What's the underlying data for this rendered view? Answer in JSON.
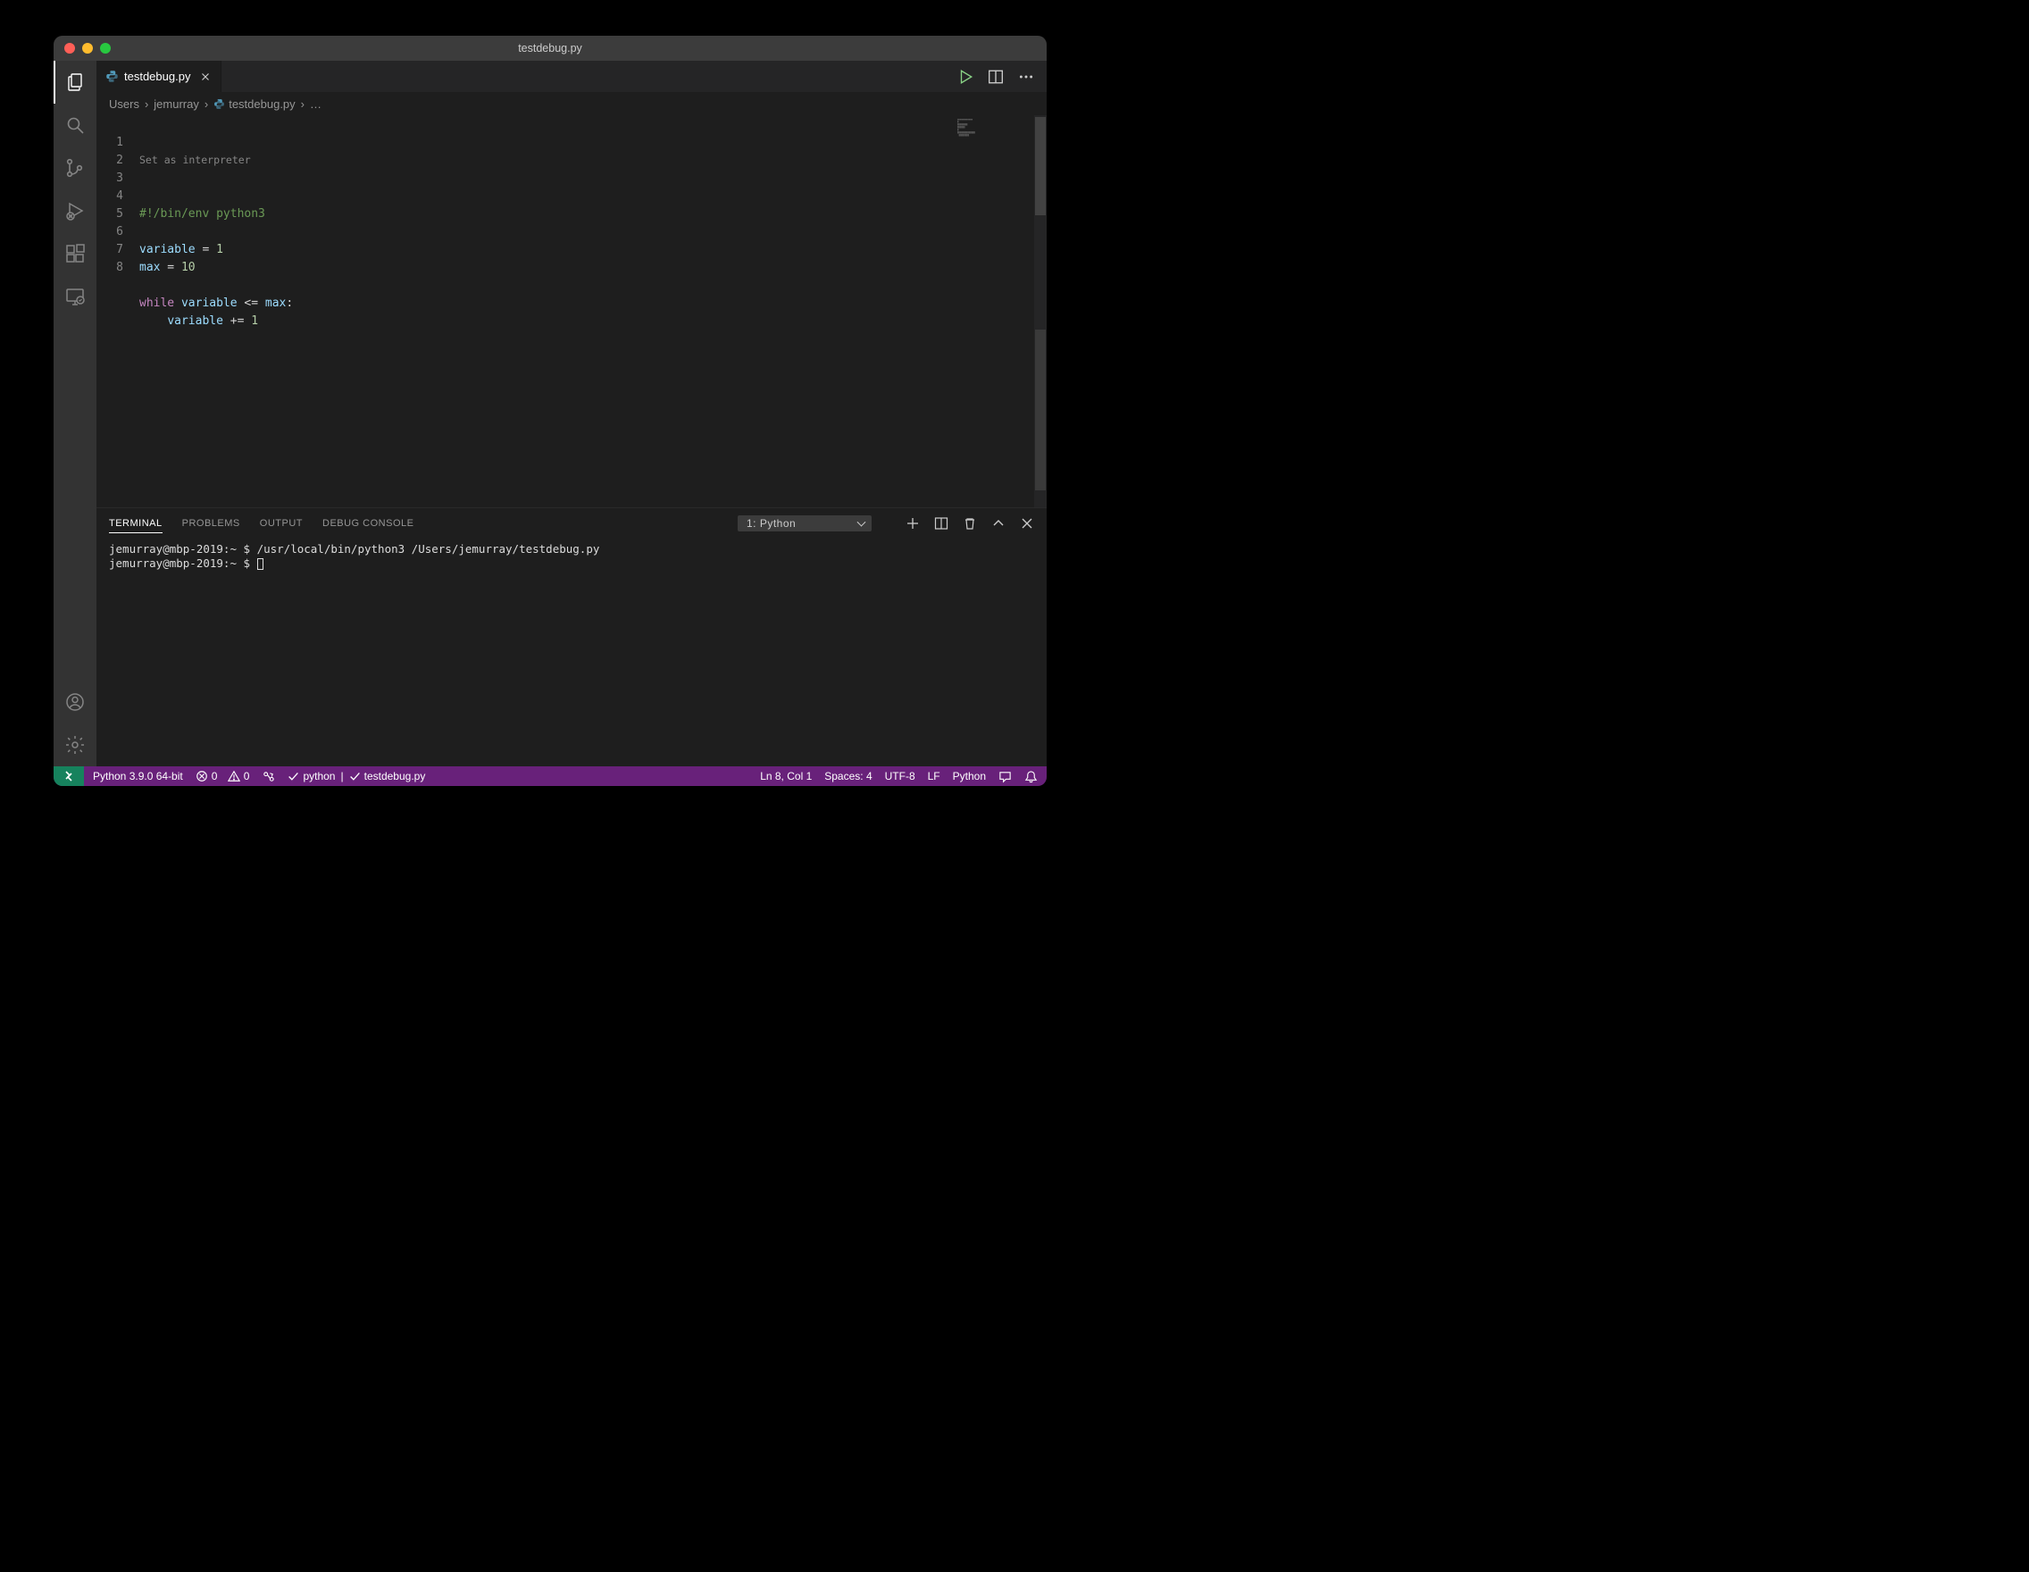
{
  "window": {
    "title": "testdebug.py"
  },
  "traffic_colors": {
    "close": "#ff5f57",
    "minimize": "#febc2e",
    "zoom": "#28c840"
  },
  "activitybar": {
    "items": [
      "files-icon",
      "search-icon",
      "source-control-icon",
      "run-debug-icon",
      "extensions-icon",
      "remote-explorer-icon"
    ],
    "bottom": [
      "accounts-icon",
      "settings-gear-icon"
    ]
  },
  "tabs": [
    {
      "label": "testdebug.py",
      "icon": "python-file-icon",
      "dirty": false,
      "active": true
    }
  ],
  "editor_actions": [
    "run-file-icon",
    "split-editor-icon",
    "more-actions-icon"
  ],
  "breadcrumbs": {
    "segments": [
      "Users",
      "jemurray",
      "testdebug.py",
      "…"
    ],
    "file_icon_at": 2
  },
  "editor": {
    "codelens": "Set as interpreter",
    "lines": [
      {
        "n": 1,
        "tokens": [
          [
            "comment",
            "#!/bin/env python3"
          ]
        ]
      },
      {
        "n": 2,
        "tokens": []
      },
      {
        "n": 3,
        "tokens": [
          [
            "var",
            "variable"
          ],
          [
            "op",
            " = "
          ],
          [
            "num",
            "1"
          ]
        ]
      },
      {
        "n": 4,
        "tokens": [
          [
            "var",
            "max"
          ],
          [
            "op",
            " = "
          ],
          [
            "num",
            "10"
          ]
        ]
      },
      {
        "n": 5,
        "tokens": []
      },
      {
        "n": 6,
        "tokens": [
          [
            "kw",
            "while"
          ],
          [
            "op",
            " "
          ],
          [
            "var",
            "variable"
          ],
          [
            "op",
            " <= "
          ],
          [
            "var",
            "max"
          ],
          [
            "op",
            ":"
          ]
        ]
      },
      {
        "n": 7,
        "tokens": [
          [
            "op",
            "    "
          ],
          [
            "var",
            "variable"
          ],
          [
            "op",
            " += "
          ],
          [
            "num",
            "1"
          ]
        ]
      },
      {
        "n": 8,
        "tokens": []
      }
    ]
  },
  "panel": {
    "tabs": [
      "TERMINAL",
      "PROBLEMS",
      "OUTPUT",
      "DEBUG CONSOLE"
    ],
    "active_tab": 0,
    "dropdown": "1: Python",
    "actions": [
      "new-terminal-icon",
      "split-terminal-icon",
      "kill-terminal-icon",
      "maximize-panel-icon",
      "close-panel-icon"
    ]
  },
  "terminal": {
    "lines": [
      {
        "prompt": "jemurray@mbp-2019:~ $ ",
        "cmd": "/usr/local/bin/python3 /Users/jemurray/testdebug.py"
      },
      {
        "prompt": "jemurray@mbp-2019:~ $ ",
        "cmd": "",
        "cursor": true
      }
    ]
  },
  "statusbar": {
    "remote_icon": "remote-icon",
    "left": {
      "interpreter": "Python 3.9.0 64-bit",
      "errors": "0",
      "warnings": "0",
      "live_share_icon": "live-share-icon",
      "checks": [
        "python",
        "testdebug.py"
      ]
    },
    "right": {
      "cursor": "Ln 8, Col 1",
      "spaces": "Spaces: 4",
      "encoding": "UTF-8",
      "eol": "LF",
      "language": "Python",
      "feedback_icon": "feedback-icon",
      "bell_icon": "bell-icon"
    }
  }
}
